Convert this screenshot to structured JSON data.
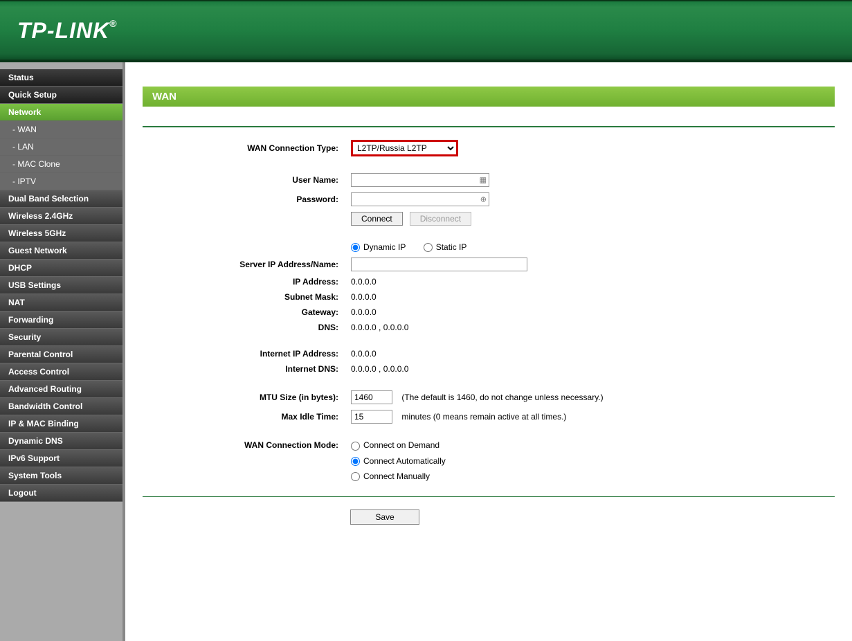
{
  "header": {
    "brand": "TP-LINK"
  },
  "sidebar": {
    "items": [
      {
        "label": "Status",
        "style": "darker"
      },
      {
        "label": "Quick Setup",
        "style": "darker"
      },
      {
        "label": "Network",
        "style": "active"
      },
      {
        "label": "- WAN",
        "style": "sub current"
      },
      {
        "label": "- LAN",
        "style": "sub"
      },
      {
        "label": "- MAC Clone",
        "style": "sub"
      },
      {
        "label": "- IPTV",
        "style": "sub"
      },
      {
        "label": "Dual Band Selection",
        "style": ""
      },
      {
        "label": "Wireless 2.4GHz",
        "style": ""
      },
      {
        "label": "Wireless 5GHz",
        "style": ""
      },
      {
        "label": "Guest Network",
        "style": ""
      },
      {
        "label": "DHCP",
        "style": ""
      },
      {
        "label": "USB Settings",
        "style": ""
      },
      {
        "label": "NAT",
        "style": ""
      },
      {
        "label": "Forwarding",
        "style": ""
      },
      {
        "label": "Security",
        "style": ""
      },
      {
        "label": "Parental Control",
        "style": ""
      },
      {
        "label": "Access Control",
        "style": ""
      },
      {
        "label": "Advanced Routing",
        "style": ""
      },
      {
        "label": "Bandwidth Control",
        "style": ""
      },
      {
        "label": "IP & MAC Binding",
        "style": ""
      },
      {
        "label": "Dynamic DNS",
        "style": ""
      },
      {
        "label": "IPv6 Support",
        "style": ""
      },
      {
        "label": "System Tools",
        "style": ""
      },
      {
        "label": "Logout",
        "style": ""
      }
    ]
  },
  "page": {
    "title": "WAN",
    "labels": {
      "conn_type": "WAN Connection Type:",
      "username": "User Name:",
      "password": "Password:",
      "server": "Server IP Address/Name:",
      "ip": "IP Address:",
      "subnet": "Subnet Mask:",
      "gateway": "Gateway:",
      "dns": "DNS:",
      "internet_ip": "Internet IP Address:",
      "internet_dns": "Internet DNS:",
      "mtu": "MTU Size (in bytes):",
      "max_idle": "Max Idle Time:",
      "conn_mode": "WAN Connection Mode:"
    },
    "values": {
      "conn_type_selected": "L2TP/Russia L2TP",
      "username": "",
      "password": "",
      "server": "",
      "ip": "0.0.0.0",
      "subnet": "0.0.0.0",
      "gateway": "0.0.0.0",
      "dns": "0.0.0.0 , 0.0.0.0",
      "internet_ip": "0.0.0.0",
      "internet_dns": "0.0.0.0 , 0.0.0.0",
      "mtu": "1460",
      "max_idle": "15"
    },
    "buttons": {
      "connect": "Connect",
      "disconnect": "Disconnect",
      "save": "Save"
    },
    "radios": {
      "ip_mode": {
        "dynamic": "Dynamic IP",
        "static": "Static IP"
      },
      "conn_mode": {
        "on_demand": "Connect on Demand",
        "auto": "Connect Automatically",
        "manual": "Connect Manually"
      }
    },
    "notes": {
      "mtu": "(The default is 1460, do not change unless necessary.)",
      "max_idle": "minutes (0 means remain active at all times.)"
    }
  }
}
